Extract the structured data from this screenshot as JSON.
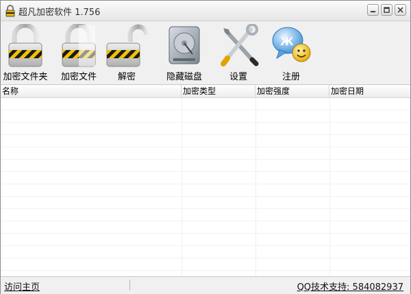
{
  "window": {
    "title": "超凡加密软件 1.756"
  },
  "toolbar": {
    "items": [
      {
        "label": "加密文件夹",
        "icon": "closed-lock-icon"
      },
      {
        "label": "加密文件",
        "icon": "half-lock-icon"
      },
      {
        "label": "解密",
        "icon": "open-lock-icon"
      },
      {
        "label": "隐藏磁盘",
        "icon": "hard-disk-icon"
      },
      {
        "label": "设置",
        "icon": "tools-icon"
      },
      {
        "label": "注册",
        "icon": "qq-smiley-icon"
      }
    ]
  },
  "list": {
    "columns": [
      "名称",
      "加密类型",
      "加密强度",
      "加密日期"
    ],
    "rows": []
  },
  "status": {
    "left_link": "访问主页",
    "right_text": "QQ技术支持: 584082937"
  },
  "colors": {
    "lock_stripe_yellow": "#f2c200",
    "lock_stripe_black": "#1a1a1a",
    "qq_blue": "#3a8fd8"
  }
}
